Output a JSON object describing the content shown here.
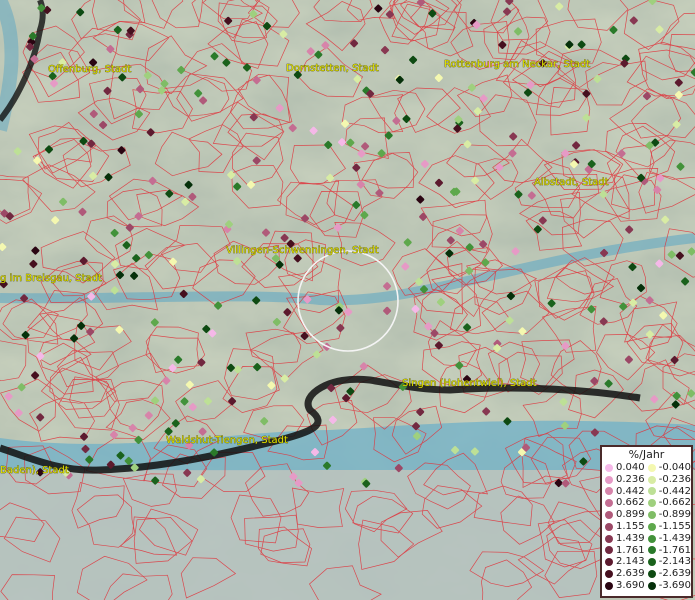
{
  "cities": [
    {
      "name": "Offenburg, Stadt"
    },
    {
      "name": "Dornstetten, Stadt"
    },
    {
      "name": "Rottenburg am Neckar, Stadt"
    },
    {
      "name": "Albstadt, Stadt"
    },
    {
      "name": "Villingen-Schwenningen, Stadt"
    },
    {
      "name": "g im Breisgau, Stadt"
    },
    {
      "name": "Singen (Hohentwiel), Stadt"
    },
    {
      "name": "Waldshut-Tiengen, Stadt"
    },
    {
      "name": "Baden), Stadt"
    }
  ],
  "legend": {
    "title": "%/Jahr",
    "positive": [
      {
        "label": "0.040",
        "color": "#f5b8e8"
      },
      {
        "label": "0.236",
        "color": "#e69ac6"
      },
      {
        "label": "0.442",
        "color": "#d784aa"
      },
      {
        "label": "0.662",
        "color": "#c46d92"
      },
      {
        "label": "0.899",
        "color": "#b05a7a"
      },
      {
        "label": "1.155",
        "color": "#9c4866"
      },
      {
        "label": "1.439",
        "color": "#883852"
      },
      {
        "label": "1.761",
        "color": "#722840"
      },
      {
        "label": "2.143",
        "color": "#5c1a2e"
      },
      {
        "label": "2.639",
        "color": "#46101f"
      },
      {
        "label": "3.690",
        "color": "#2a0512"
      }
    ],
    "negative": [
      {
        "label": "-0.040",
        "color": "#f4f8b0"
      },
      {
        "label": "-0.236",
        "color": "#d8eca4"
      },
      {
        "label": "-0.442",
        "color": "#bde096"
      },
      {
        "label": "-0.662",
        "color": "#9fd07e"
      },
      {
        "label": "-0.899",
        "color": "#7fbd66"
      },
      {
        "label": "-1.155",
        "color": "#5ea84c"
      },
      {
        "label": "-1.439",
        "color": "#42923a"
      },
      {
        "label": "-1.761",
        "color": "#2a7a2a"
      },
      {
        "label": "-2.143",
        "color": "#1a621c"
      },
      {
        "label": "-2.639",
        "color": "#0e4a12"
      },
      {
        "label": "-3.690",
        "color": "#05300a"
      }
    ]
  }
}
